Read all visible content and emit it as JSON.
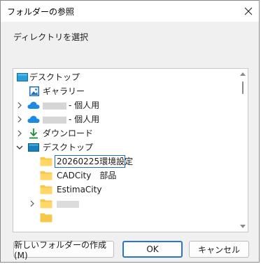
{
  "window": {
    "title": "フォルダーの参照"
  },
  "instruction": "ディレクトリを選択",
  "tree": {
    "items": [
      {
        "label": "デスクトップ",
        "icon": "desktop-icon",
        "expanded": true
      },
      {
        "label": "ギャラリー",
        "icon": "gallery-icon"
      },
      {
        "label": "- 個人用",
        "icon": "onedrive-cloud-icon",
        "redacted": true
      },
      {
        "label": "- 個人用",
        "icon": "onedrive-cloud-icon",
        "redacted": true
      },
      {
        "label": "ダウンロード",
        "icon": "download-icon"
      },
      {
        "label": "デスクトップ",
        "icon": "desktop-icon",
        "expanded": true
      },
      {
        "label": "20260225環境設定",
        "icon": "folder-icon",
        "selected": true
      },
      {
        "label": "CADCity　部品",
        "icon": "folder-icon"
      },
      {
        "label": "EstimaCity",
        "icon": "folder-icon"
      },
      {
        "label": "",
        "icon": "folder-icon",
        "redacted": true
      }
    ]
  },
  "buttons": {
    "new_folder": "新しいフォルダーの作成(M)",
    "ok": "OK",
    "cancel": "キャンセル"
  },
  "colors": {
    "selection_border": "#1f6fbf",
    "folder_yellow": "#f6c84a",
    "onedrive_blue": "#1e88e5",
    "primary_button_border": "#2b74c7"
  }
}
